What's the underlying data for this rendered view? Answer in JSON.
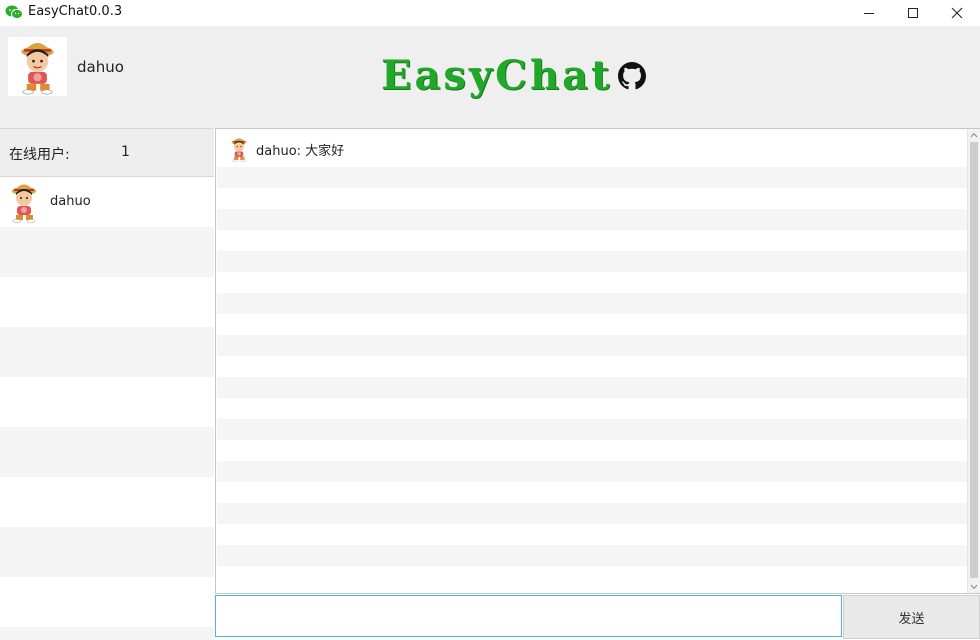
{
  "window": {
    "title": "EasyChat0.0.3",
    "icon": "wechat-icon",
    "controls": [
      "minimize-icon",
      "maximize-icon",
      "close-icon"
    ]
  },
  "header": {
    "self_name": "dahuo",
    "self_avatar": "cartoon-avatar",
    "logo_text": "EasyChat",
    "logo_icon": "github-icon",
    "logo_color": "#22a829"
  },
  "online": {
    "label": "在线用户:",
    "count": "1"
  },
  "users": [
    {
      "name": "dahuo",
      "avatar": "cartoon-avatar"
    }
  ],
  "messages": [
    {
      "sender": "dahuo",
      "text": "dahuo: 大家好",
      "avatar": "cartoon-avatar"
    }
  ],
  "input": {
    "value": "",
    "placeholder": ""
  },
  "send_button": {
    "label": "发送"
  },
  "colors": {
    "header_bg": "#efefef",
    "stripe": "#f5f5f5",
    "input_border": "#4fb0e6",
    "button_bg": "#e9e9e9"
  }
}
